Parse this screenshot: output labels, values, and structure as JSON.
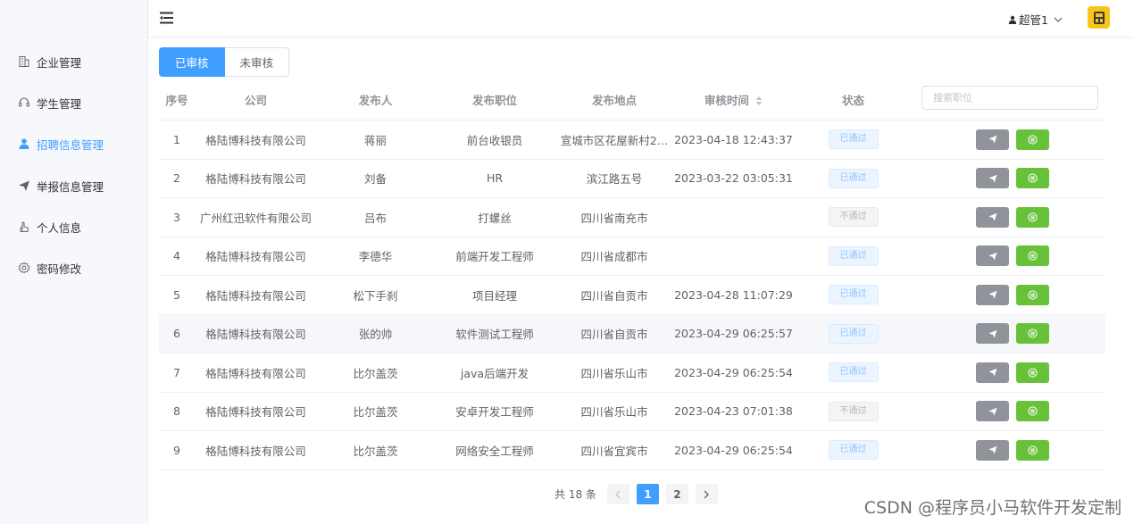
{
  "sidebar": {
    "items": [
      {
        "label": "企业管理",
        "icon": "building-icon"
      },
      {
        "label": "学生管理",
        "icon": "headset-icon"
      },
      {
        "label": "招聘信息管理",
        "icon": "user-icon"
      },
      {
        "label": "举报信息管理",
        "icon": "send-icon"
      },
      {
        "label": "个人信息",
        "icon": "hand-icon"
      },
      {
        "label": "密码修改",
        "icon": "gear-icon"
      }
    ]
  },
  "header": {
    "user_name": "超管1",
    "user_icon": "user-icon",
    "dropdown_icon": "chevron-down-icon"
  },
  "tabs": [
    {
      "label": "已审核"
    },
    {
      "label": "未审核"
    }
  ],
  "search": {
    "placeholder": "搜索职位"
  },
  "table": {
    "columns": [
      "序号",
      "公司",
      "发布人",
      "发布职位",
      "发布地点",
      "审核时间",
      "状态"
    ],
    "rows": [
      {
        "no": "1",
        "company": "格陆博科技有限公司",
        "publisher": "蒋丽",
        "position": "前台收银员",
        "location": "宣城市区花屋新村2…",
        "time": "2023-04-18 12:43:37",
        "status": "已通过"
      },
      {
        "no": "2",
        "company": "格陆博科技有限公司",
        "publisher": "刘备",
        "position": "HR",
        "location": "滨江路五号",
        "time": "2023-03-22 03:05:31",
        "status": "已通过"
      },
      {
        "no": "3",
        "company": "广州红迅软件有限公司",
        "publisher": "吕布",
        "position": "打螺丝",
        "location": "四川省南充市",
        "time": "",
        "status": "不通过"
      },
      {
        "no": "4",
        "company": "格陆博科技有限公司",
        "publisher": "李德华",
        "position": "前端开发工程师",
        "location": "四川省成都市",
        "time": "",
        "status": "已通过"
      },
      {
        "no": "5",
        "company": "格陆博科技有限公司",
        "publisher": "松下手刹",
        "position": "项目经理",
        "location": "四川省自贡市",
        "time": "2023-04-28 11:07:29",
        "status": "已通过"
      },
      {
        "no": "6",
        "company": "格陆博科技有限公司",
        "publisher": "张的帅",
        "position": "软件测试工程师",
        "location": "四川省自贡市",
        "time": "2023-04-29 06:25:57",
        "status": "已通过"
      },
      {
        "no": "7",
        "company": "格陆博科技有限公司",
        "publisher": "比尔盖茨",
        "position": "java后端开发",
        "location": "四川省乐山市",
        "time": "2023-04-29 06:25:54",
        "status": "已通过"
      },
      {
        "no": "8",
        "company": "格陆博科技有限公司",
        "publisher": "比尔盖茨",
        "position": "安卓开发工程师",
        "location": "四川省乐山市",
        "time": "2023-04-23 07:01:38",
        "status": "不通过"
      },
      {
        "no": "9",
        "company": "格陆博科技有限公司",
        "publisher": "比尔盖茨",
        "position": "网络安全工程师",
        "location": "四川省宜宾市",
        "time": "2023-04-29 06:25:54",
        "status": "已通过"
      }
    ]
  },
  "pagination": {
    "total_text": "共 18 条",
    "pages": [
      "1",
      "2"
    ],
    "current": "1"
  },
  "watermark": "CSDN @程序员小马软件开发定制",
  "colors": {
    "primary": "#409eff",
    "success": "#67c23a",
    "info": "#909399",
    "avatar_bg": "#f5c518"
  }
}
